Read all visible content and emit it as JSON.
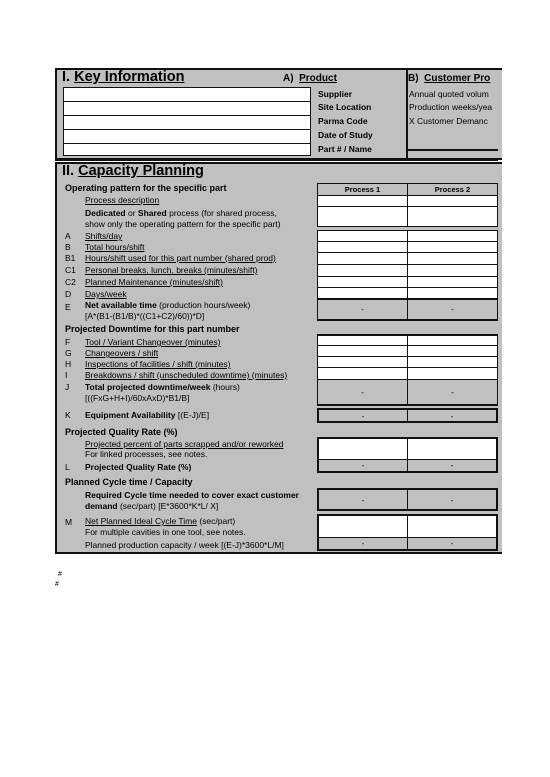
{
  "key_info": {
    "title_prefix": "I.",
    "title": "Key Information",
    "blank_fields": [
      "",
      "",
      "",
      "",
      ""
    ]
  },
  "product": {
    "title_prefix": "A)",
    "title": "Product",
    "labels": [
      "Supplier",
      "Site Location",
      "Parma Code",
      "Date of Study",
      "Part # / Name"
    ]
  },
  "customer": {
    "title_prefix": "B)",
    "title": "Customer Pro",
    "labels": [
      "Annual quoted volum",
      "Production weeks/yea",
      "X  Customer Demanc"
    ]
  },
  "capacity": {
    "title_prefix": "II.",
    "title": "Capacity Planning",
    "columns": [
      "Process 1",
      "Process 2"
    ],
    "operating_heading": "Operating pattern for the specific part",
    "process_description": "Process description",
    "dedicated_line1_bold1": "Dedicated",
    "dedicated_line1_mid": " or ",
    "dedicated_line1_bold2": "Shared",
    "dedicated_line1_rest": " process  (for shared process,",
    "dedicated_line2": "show only the operating pattern for the specific part)",
    "rows_op": [
      {
        "code": "A",
        "label": "Shifts/day"
      },
      {
        "code": "B",
        "label": "Total hours/shift"
      },
      {
        "code": "B1",
        "label": "Hours/shift used for this part number (shared prod)"
      },
      {
        "code": "C1",
        "label": "Personal breaks, lunch, breaks    (minutes/shift)"
      },
      {
        "code": "C2",
        "label": "Planned Maintenance    (minutes/shift)"
      },
      {
        "code": "D",
        "label": "Days/week"
      }
    ],
    "net_time": {
      "code": "E",
      "label_bold": "Net available time",
      "label_rest": "   (production hours/week)",
      "formula": "[A*(B1-(B1/B)*((C1+C2)/60))*D]",
      "values": [
        "-",
        "-"
      ]
    },
    "downtime_heading": "Projected Downtime for this part number",
    "rows_down": [
      {
        "code": "F",
        "label": "Tool / Variant  Changeover (minutes)"
      },
      {
        "code": "G",
        "label": "Changeovers / shift"
      },
      {
        "code": "H",
        "label": "Inspections of facilities / shift  (minutes)"
      },
      {
        "code": "I",
        "label": "Breakdowns / shift  (unscheduled downtime)   (minutes)"
      }
    ],
    "total_downtime": {
      "code": "J",
      "label_bold": "Total projected downtime/week",
      "label_rest": " (hours)",
      "formula": "[((FxG+H+I)/60xAxD)*B1/B]",
      "values": [
        "-",
        "-"
      ]
    },
    "availability": {
      "code": "K",
      "label_bold": "Equipment Availability",
      "label_rest": "   [(E-J)/E]",
      "values": [
        "-",
        "-"
      ]
    },
    "quality_heading": "Projected Quality Rate (%)",
    "scrap_label": "Projected percent of parts scrapped and/or reworked",
    "scrap_note": "For linked processes, see notes.",
    "quality_rate": {
      "code": "L",
      "label": "Projected Quality Rate (%)",
      "values": [
        "-",
        "-"
      ]
    },
    "cycle_heading": "Planned Cycle time / Capacity",
    "required_cycle": {
      "line1": "Required Cycle time needed to cover exact customer",
      "line2_bold": "demand",
      "line2_rest": "  (sec/part)     [E*3600*K*L/ X]",
      "values": [
        "-",
        "-"
      ]
    },
    "net_cycle": {
      "code": "M",
      "label": "Net Planned Ideal Cycle Time",
      "label_rest": "  (sec/part)",
      "note": "For multiple cavities in one tool, see notes."
    },
    "planned_capacity": {
      "label": "Planned production capacity / week  [(E-J)*3600*L/M]",
      "values": [
        "-",
        "-"
      ]
    }
  },
  "footer_marks": [
    "#",
    "#"
  ]
}
